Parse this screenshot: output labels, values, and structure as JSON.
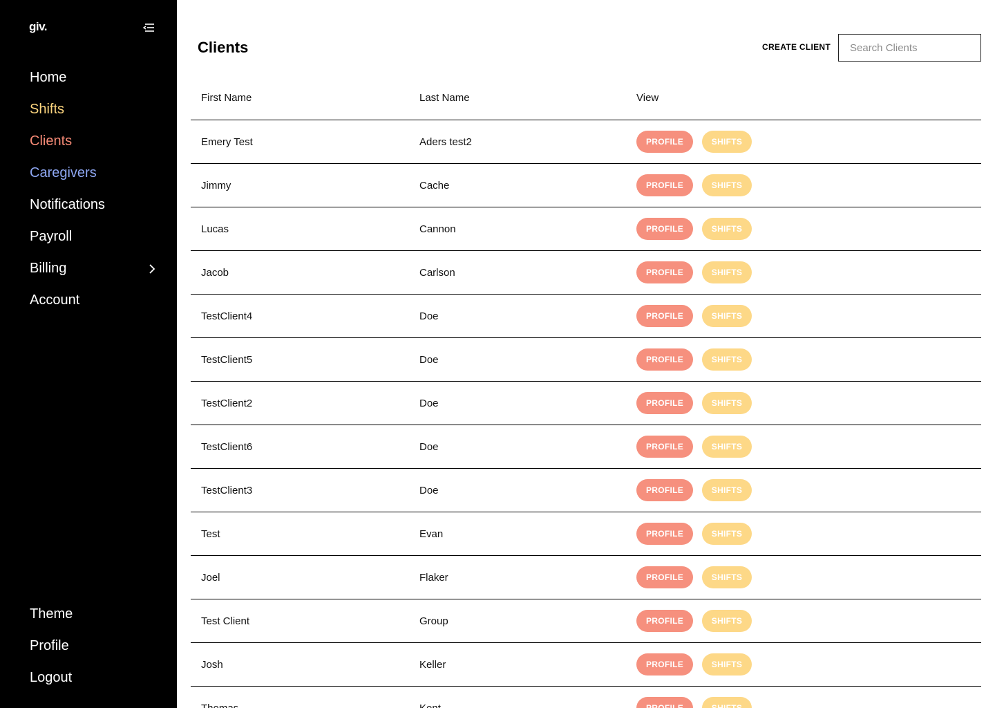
{
  "app": {
    "logo": "giv."
  },
  "colors": {
    "sidebar_bg": "#000000",
    "nav_default": "#ffffff",
    "nav_shifts": "#fcd57e",
    "nav_clients": "#f68a76",
    "nav_caregivers": "#8ea7f2",
    "profile_pill": "#f6907e",
    "shifts_pill": "#fdd887"
  },
  "sidebar": {
    "items": [
      {
        "label": "Home",
        "color": "#ffffff"
      },
      {
        "label": "Shifts",
        "color": "#fcd57e"
      },
      {
        "label": "Clients",
        "color": "#f68a76"
      },
      {
        "label": "Caregivers",
        "color": "#8ea7f2"
      },
      {
        "label": "Notifications",
        "color": "#ffffff"
      },
      {
        "label": "Payroll",
        "color": "#ffffff"
      },
      {
        "label": "Billing",
        "color": "#ffffff",
        "has_chevron": true
      },
      {
        "label": "Account",
        "color": "#ffffff"
      }
    ],
    "bottom_items": [
      {
        "label": "Theme"
      },
      {
        "label": "Profile"
      },
      {
        "label": "Logout"
      }
    ]
  },
  "header": {
    "title": "Clients",
    "create_label": "CREATE CLIENT",
    "search_placeholder": "Search Clients",
    "search_value": ""
  },
  "table": {
    "columns": [
      "First Name",
      "Last Name",
      "View"
    ],
    "profile_label": "PROFILE",
    "shifts_label": "SHIFTS",
    "rows": [
      {
        "first": "Emery Test",
        "last": "Aders test2"
      },
      {
        "first": "Jimmy",
        "last": "Cache"
      },
      {
        "first": "Lucas",
        "last": "Cannon"
      },
      {
        "first": "Jacob",
        "last": "Carlson"
      },
      {
        "first": "TestClient4",
        "last": "Doe"
      },
      {
        "first": "TestClient5",
        "last": "Doe"
      },
      {
        "first": "TestClient2",
        "last": "Doe"
      },
      {
        "first": "TestClient6",
        "last": "Doe"
      },
      {
        "first": "TestClient3",
        "last": "Doe"
      },
      {
        "first": "Test",
        "last": "Evan"
      },
      {
        "first": "Joel",
        "last": "Flaker"
      },
      {
        "first": "Test Client",
        "last": "Group"
      },
      {
        "first": "Josh",
        "last": "Keller"
      },
      {
        "first": "Thomas",
        "last": "Kent"
      }
    ]
  }
}
